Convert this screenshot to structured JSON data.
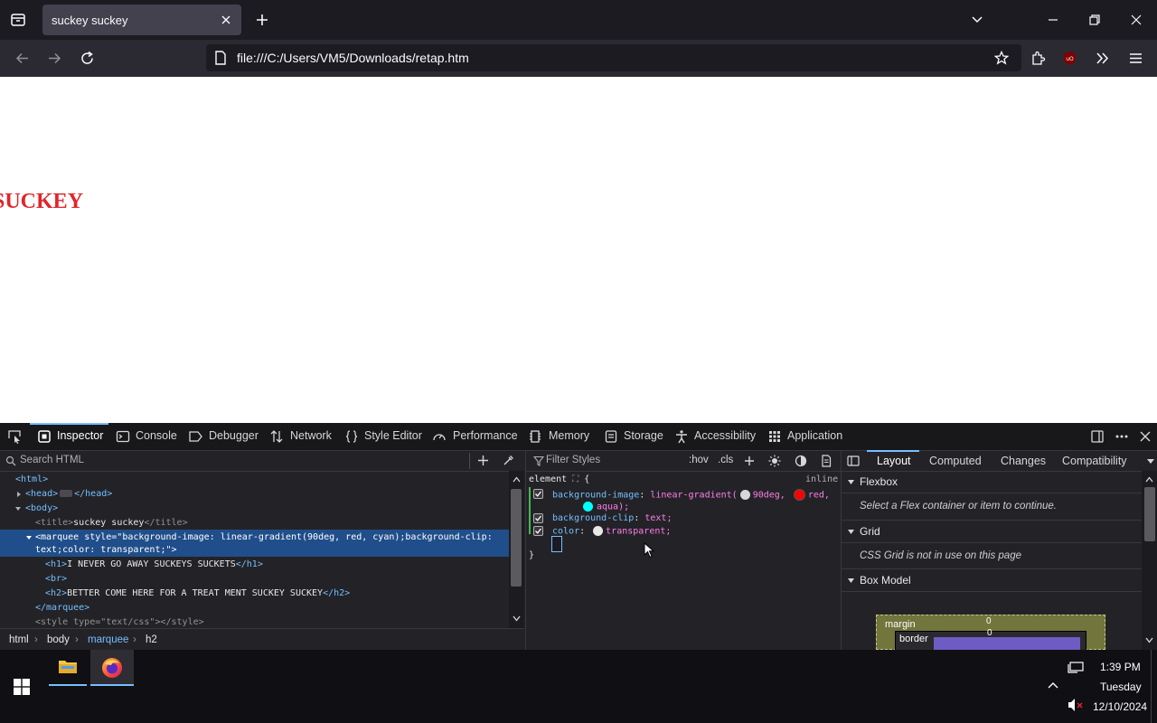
{
  "browser": {
    "tab_title": "suckey suckey",
    "url": "file:///C:/Users/VM5/Downloads/retap.htm"
  },
  "page": {
    "marquee_h1_visible": "SUCKEY"
  },
  "devtools": {
    "tabs": [
      "Inspector",
      "Console",
      "Debugger",
      "Network",
      "Style Editor",
      "Performance",
      "Memory",
      "Storage",
      "Accessibility",
      "Application"
    ],
    "search_placeholder": "Search HTML",
    "markup": {
      "html_open": "<html>",
      "head": "<head>",
      "head_close": "</head>",
      "body_open": "<body>",
      "title_open": "<title>",
      "title_text": "suckey suckey",
      "title_close": "</title>",
      "marquee_line1": "style=\"background-image: linear-gradient(90deg, red, cyan);background-clip:",
      "marquee_line2": "text;color: transparent;\">",
      "h1_text": "I NEVER GO AWAY SUCKEYS SUCKETS",
      "br": "<br>",
      "h2_text": "BETTER COME HERE FOR A TREAT MENT SUCKEY SUCKEY",
      "marquee_close": "</marquee>",
      "style_line": "<style type=\"text/css\"></style>"
    },
    "breadcrumbs": [
      "html",
      "body",
      "marquee",
      "h2"
    ],
    "rules": {
      "filter_placeholder": "Filter Styles",
      "hov": ":hov",
      "cls": ".cls",
      "selector": "element",
      "source": "inline",
      "decl1_prop": "background-image",
      "decl1_val_a": "linear-gradient(",
      "decl1_val_b": "90deg,",
      "decl1_val_c": "red,",
      "decl1_val_d": "aqua);",
      "decl2_prop": "background-clip",
      "decl2_val": "text;",
      "decl3_prop": "color",
      "decl3_val": "transparent;"
    },
    "layout": {
      "tabs": [
        "Layout",
        "Computed",
        "Changes",
        "Compatibility"
      ],
      "flexbox_title": "Flexbox",
      "flexbox_msg": "Select a Flex container or item to continue.",
      "grid_title": "Grid",
      "grid_msg": "CSS Grid is not in use on this page",
      "boxmodel_title": "Box Model",
      "margin_label": "margin",
      "margin_value": "0",
      "border_label": "border",
      "border_value": "0"
    }
  },
  "taskbar": {
    "time": "1:39 PM",
    "day": "Tuesday",
    "date": "12/10/2024"
  },
  "colors": {
    "accent": "#75bfff",
    "selection": "#204e8a",
    "red_swatch": "#ff0000",
    "aqua_swatch": "#00ffff",
    "margin_box": "#72753c",
    "border_box": "#6e5cc4"
  }
}
